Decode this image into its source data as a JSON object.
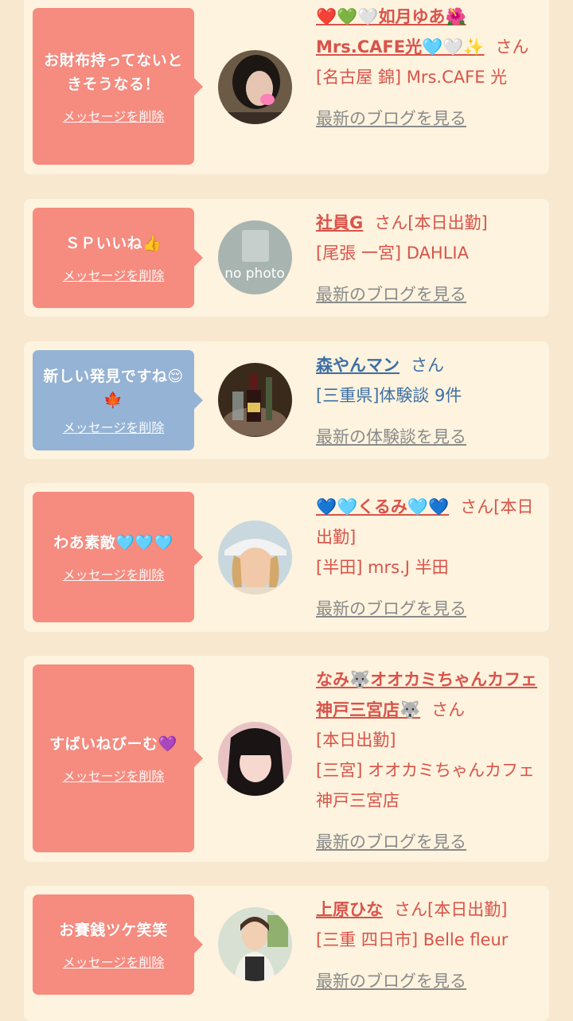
{
  "delete_label": "メッセージを削除",
  "colors": {
    "background": "#f7e8cf",
    "card": "#fdf3de",
    "bubble_pink": "#f68b7f",
    "bubble_blue": "#95b3d5",
    "name_red": "#d9534a",
    "name_blue": "#3d6fa6",
    "link_gray": "#8a8a8a"
  },
  "cards": [
    {
      "message": "お財布持ってないときそうなる！",
      "name": "❤️💚🤍如月ゆあ🌺Mrs.CAFE光🩵🤍✨",
      "suffix": "さん",
      "shop": "[名古屋 錦] Mrs.CAFE 光",
      "link": "最新のブログを見る",
      "avatar_icon": "woman-dark-hair-photo-icon"
    },
    {
      "message": "ＳＰいいね👍",
      "name": "社員G",
      "suffix": "さん[本日出勤]",
      "shop": "[尾張 一宮] DAHLIA",
      "link": "最新のブログを見る",
      "avatar_icon": "no-photo-icon",
      "avatar_text": "no photo"
    },
    {
      "message": "新しい発見ですね😌🍁",
      "name": "森やんマン",
      "suffix": "さん",
      "shop": "[三重県]体験談 9件",
      "link": "最新の体験談を見る",
      "avatar_icon": "champagne-bottles-photo-icon"
    },
    {
      "message": "わあ素敵🩵🩵🩵",
      "name": "💙🩵くるみ🩵💙",
      "suffix": "さん[本日出勤]",
      "shop": "[半田] mrs.J 半田",
      "link": "最新のブログを見る",
      "avatar_icon": "woman-cap-photo-icon"
    },
    {
      "message": "すばいねびーむ💜",
      "name": "なみ🐺オオカミちゃんカフェ神戸三宮店🐺",
      "suffix": "さん",
      "status": "[本日出勤]",
      "shop": "[三宮] オオカミちゃんカフェ神戸三宮店",
      "link": "最新のブログを見る",
      "avatar_icon": "woman-bangs-photo-icon"
    },
    {
      "message": "お賽銭ツケ笑笑",
      "name": "上原ひな",
      "suffix": "さん[本日出勤]",
      "shop": "[三重 四日市] Belle fleur",
      "link": "最新のブログを見る",
      "avatar_icon": "woman-apron-photo-icon"
    }
  ]
}
